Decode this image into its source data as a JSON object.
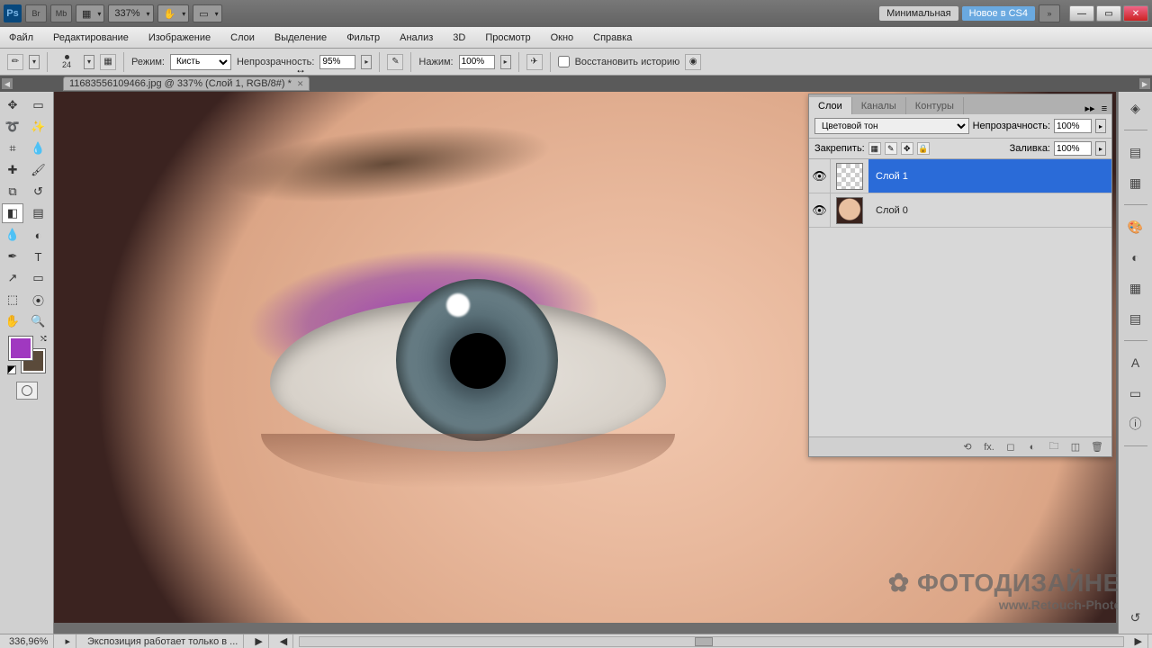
{
  "titlebar": {
    "zoom": "337%",
    "workspace_label": "Минимальная",
    "new_badge": "Новое в CS4"
  },
  "menu": {
    "items": [
      "Файл",
      "Редактирование",
      "Изображение",
      "Слои",
      "Выделение",
      "Фильтр",
      "Анализ",
      "3D",
      "Просмотр",
      "Окно",
      "Справка"
    ]
  },
  "options": {
    "brush_size": "24",
    "mode_label": "Режим:",
    "mode_value": "Кисть",
    "opacity_label": "Непрозрачность:",
    "opacity_value": "95%",
    "flow_label": "Нажим:",
    "flow_value": "100%",
    "erase_history": "Восстановить историю"
  },
  "document": {
    "tab_title": "11683556109466.jpg @ 337% (Слой 1, RGB/8#) *"
  },
  "layers_panel": {
    "tabs": [
      "Слои",
      "Каналы",
      "Контуры"
    ],
    "blend_mode": "Цветовой тон",
    "opacity_label": "Непрозрачность:",
    "opacity_value": "100%",
    "lock_label": "Закрепить:",
    "fill_label": "Заливка:",
    "fill_value": "100%",
    "layers": [
      {
        "name": "Слой 1",
        "selected": true,
        "thumb": "checker"
      },
      {
        "name": "Слой 0",
        "selected": false,
        "thumb": "face"
      }
    ]
  },
  "watermark": {
    "big": "✿ ФОТОДИЗАЙНЕР",
    "small": "www.Retouch-Photo.ru"
  },
  "status": {
    "zoom": "336,96%",
    "info": "Экспозиция работает только в ..."
  },
  "colors": {
    "foreground": "#a038c0",
    "background": "#5a4a3a"
  }
}
